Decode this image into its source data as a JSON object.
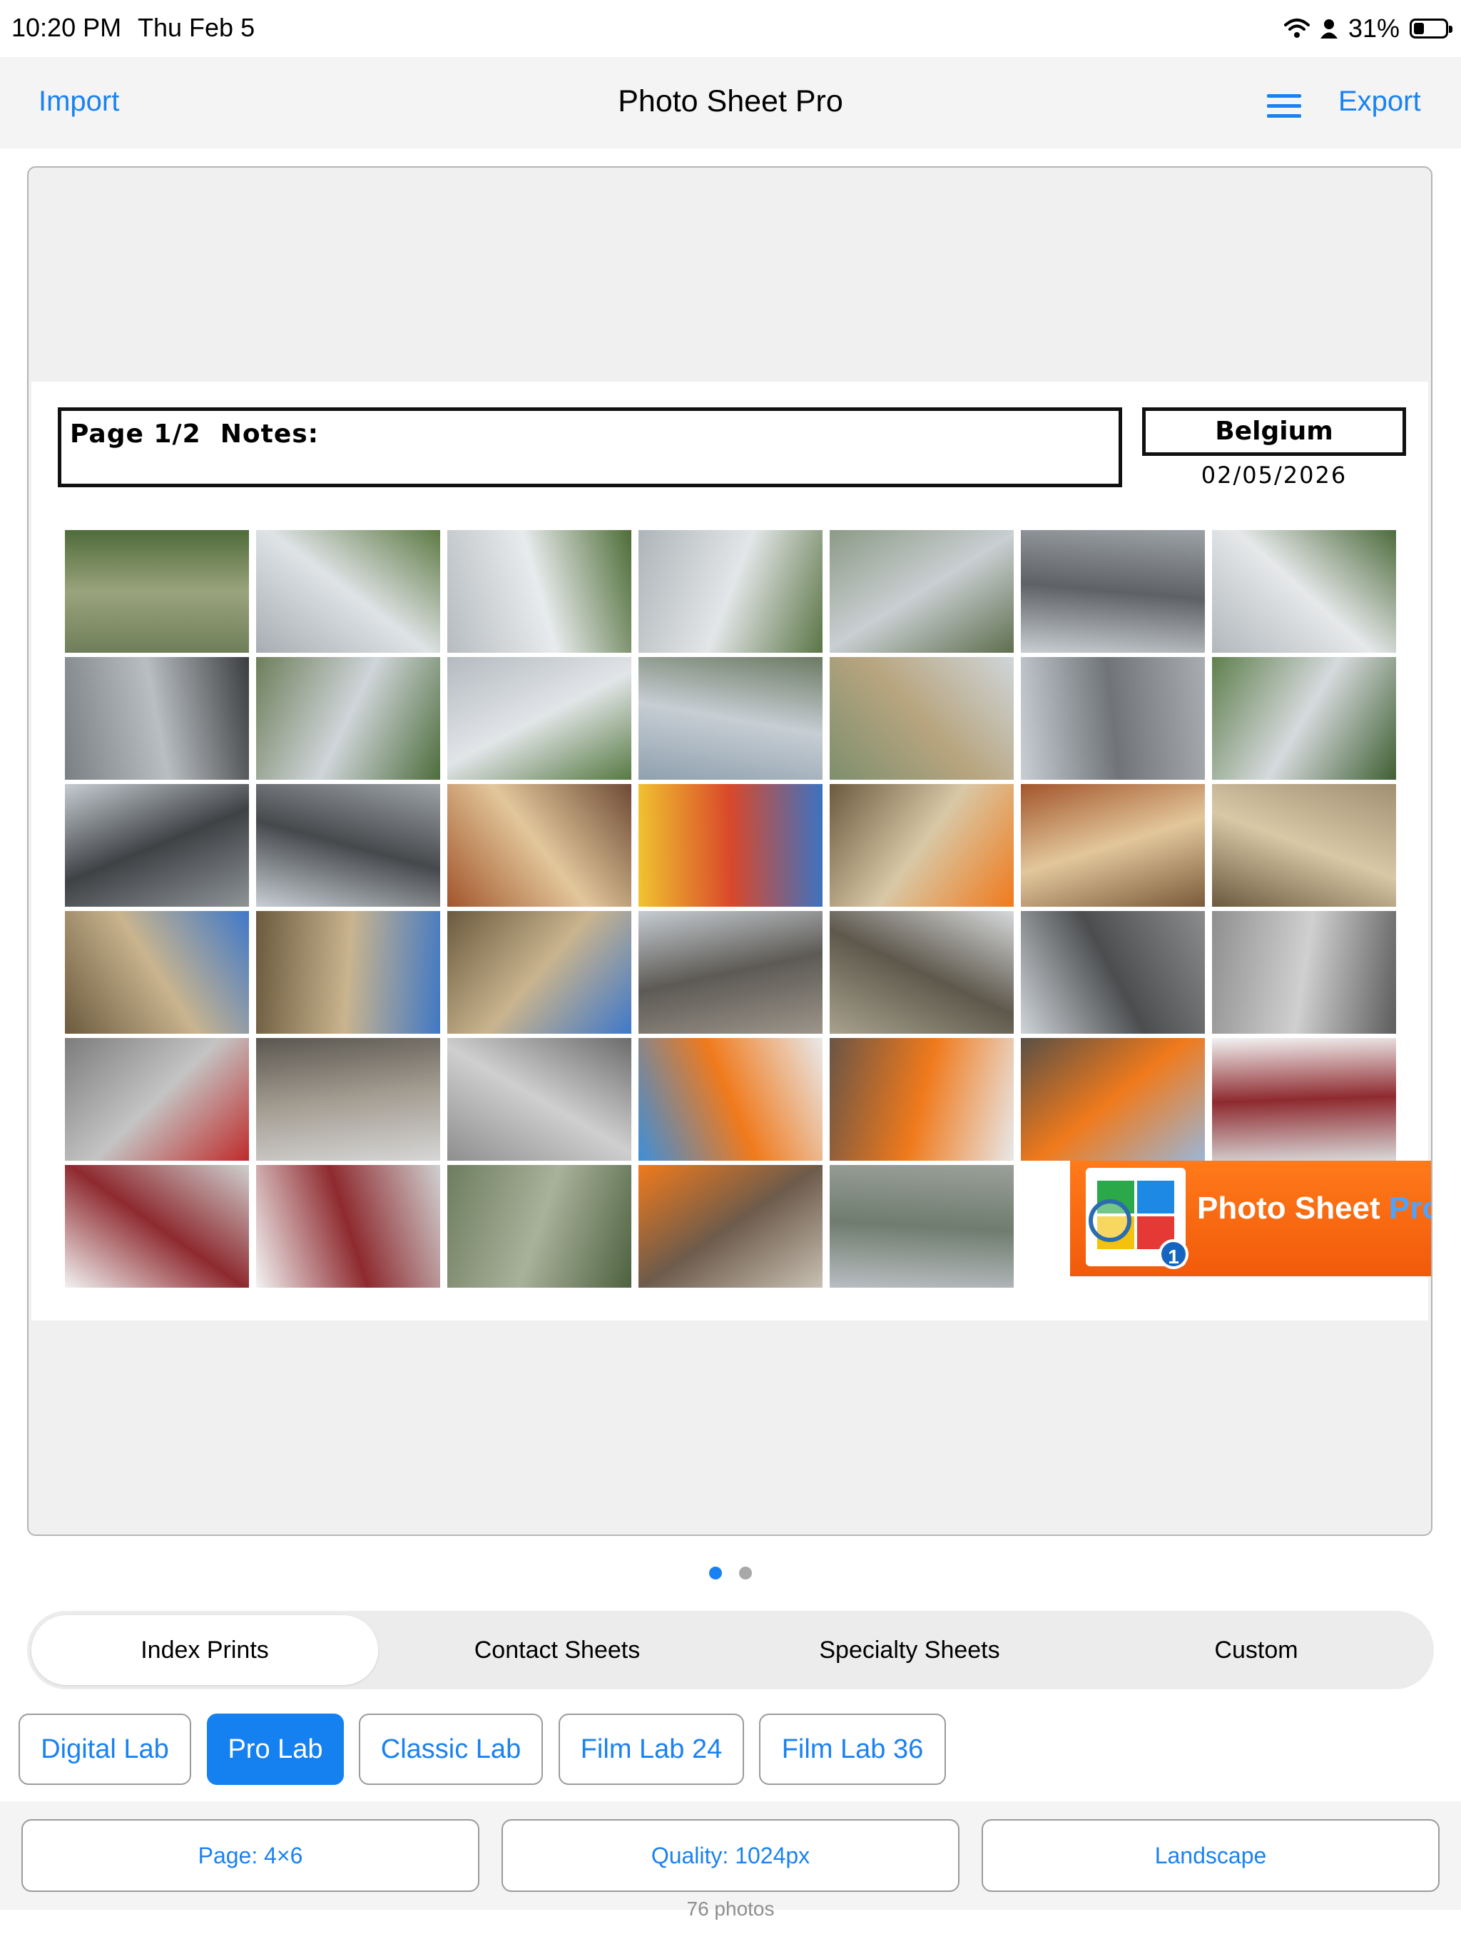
{
  "status_bar": {
    "time": "10:20 PM",
    "date": "Thu Feb 5",
    "battery": "31%",
    "battery_level": 0.31,
    "icons": [
      "wifi-icon",
      "person-icon",
      "battery-icon"
    ]
  },
  "nav": {
    "import_label": "Import",
    "title": "Photo Sheet Pro",
    "menu_icon": "hamburger-menu-icon",
    "export_label": "Export"
  },
  "sheet": {
    "page_notes": "Page 1/2  Notes:",
    "location": "Belgium",
    "date": "02/05/2026",
    "logo_text": "Photo Sheet ",
    "logo_text_pro": "Pro",
    "logo_badge": "1"
  },
  "pager": {
    "pages": 2,
    "current": 1
  },
  "tabs": [
    "Index Prints",
    "Contact Sheets",
    "Specialty Sheets",
    "Custom"
  ],
  "active_tab": 0,
  "labs": [
    "Digital Lab",
    "Pro Lab",
    "Classic Lab",
    "Film Lab 24",
    "Film Lab 36"
  ],
  "active_lab": 1,
  "options": {
    "page": "Page: 4×6",
    "quality": "Quality: 1024px",
    "orientation": "Landscape"
  },
  "photo_count": "76 photos",
  "colors": {
    "accent": "#1a82f0",
    "active_button": "#1580f0",
    "logo_orange": "#f15a0a"
  }
}
